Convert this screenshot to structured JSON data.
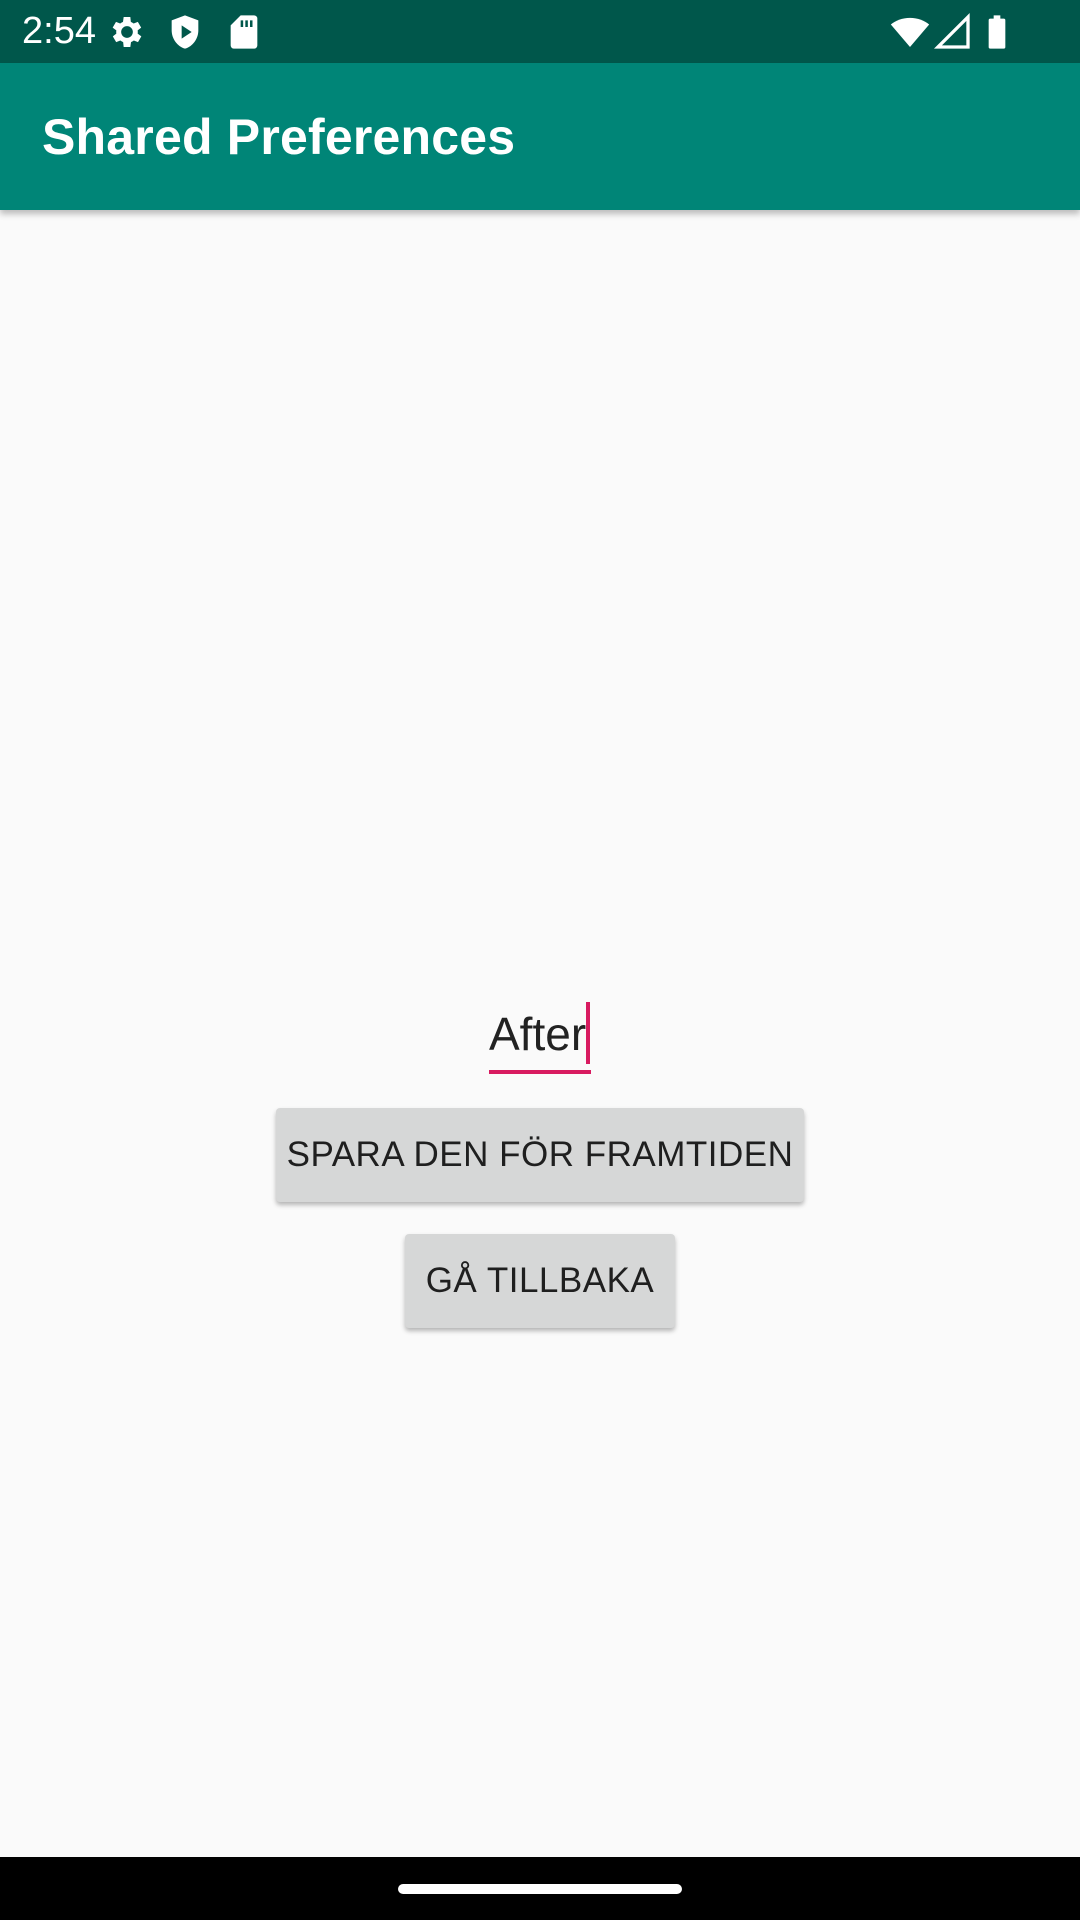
{
  "status_bar": {
    "time": "2:54",
    "icons": [
      "gear-icon",
      "shield-play-icon",
      "sd-card-icon",
      "wifi-icon",
      "signal-icon",
      "battery-icon"
    ]
  },
  "app_bar": {
    "title": "Shared Preferences",
    "background_color": "#008577",
    "status_color": "#00574b"
  },
  "content": {
    "edit_text_value": "After",
    "accent_color": "#d81b60",
    "buttons": {
      "save_label": "SPARA DEN FÖR FRAMTIDEN",
      "back_label": "GÅ TILLBAKA"
    }
  }
}
